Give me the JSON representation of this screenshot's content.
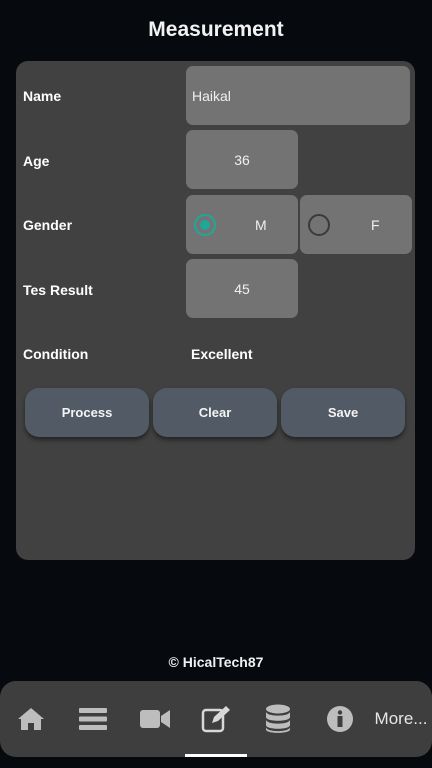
{
  "header": {
    "title": "Measurement"
  },
  "form": {
    "name": {
      "label": "Name",
      "value": "Haikal"
    },
    "age": {
      "label": "Age",
      "value": "36"
    },
    "gender": {
      "label": "Gender",
      "options": [
        {
          "label": "M",
          "selected": true
        },
        {
          "label": "F",
          "selected": false
        }
      ]
    },
    "test_result": {
      "label": "Tes Result",
      "value": "45"
    },
    "condition": {
      "label": "Condition",
      "value": "Excellent"
    }
  },
  "buttons": {
    "process": "Process",
    "clear": "Clear",
    "save": "Save"
  },
  "footer": {
    "copyright": "© HicalTech87"
  },
  "nav": {
    "items": [
      {
        "icon": "home-icon"
      },
      {
        "icon": "list-icon"
      },
      {
        "icon": "video-icon"
      },
      {
        "icon": "edit-icon",
        "active": true
      },
      {
        "icon": "database-icon"
      },
      {
        "icon": "info-icon"
      }
    ],
    "more_label": "More..."
  },
  "colors": {
    "background": "#06090e",
    "card": "#414141",
    "field": "#737373",
    "accent": "#1fa89a",
    "button": "#525a66"
  }
}
